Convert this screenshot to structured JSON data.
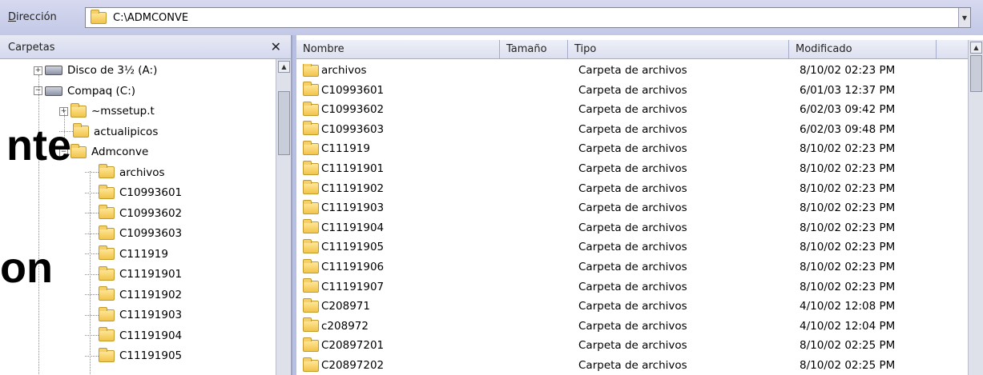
{
  "address": {
    "label_u": "D",
    "label_rest": "irección",
    "path": "C:\\ADMCONVE",
    "dropdown_glyph": "▼"
  },
  "folders_pane": {
    "title": "Carpetas",
    "close_glyph": "✕",
    "tree": [
      {
        "label": "Disco de 3½ (A:)",
        "expander": "+",
        "icon": "floppy-drive-icon"
      },
      {
        "label": "Compaq (C:)",
        "expander": "−",
        "icon": "hard-drive-icon"
      },
      {
        "label": "~mssetup.t",
        "expander": "+",
        "icon": "folder-icon"
      },
      {
        "label": "actualipicos",
        "expander": "",
        "icon": "folder-icon"
      },
      {
        "label": "Admconve",
        "expander": "−",
        "icon": "folder-icon"
      },
      {
        "label": "archivos",
        "expander": "",
        "icon": "folder-icon"
      },
      {
        "label": "C10993601",
        "expander": "",
        "icon": "folder-icon"
      },
      {
        "label": "C10993602",
        "expander": "",
        "icon": "folder-icon"
      },
      {
        "label": "C10993603",
        "expander": "",
        "icon": "folder-icon"
      },
      {
        "label": "C111919",
        "expander": "",
        "icon": "folder-icon"
      },
      {
        "label": "C11191901",
        "expander": "",
        "icon": "folder-icon"
      },
      {
        "label": "C11191902",
        "expander": "",
        "icon": "folder-icon"
      },
      {
        "label": "C11191903",
        "expander": "",
        "icon": "folder-icon"
      },
      {
        "label": "C11191904",
        "expander": "",
        "icon": "folder-icon"
      },
      {
        "label": "C11191905",
        "expander": "",
        "icon": "folder-icon"
      }
    ]
  },
  "overlay": {
    "line1": "nte",
    "line2": "on"
  },
  "files": {
    "columns": [
      "Nombre",
      "Tamaño",
      "Tipo",
      "Modificado"
    ],
    "rows": [
      {
        "name": "archivos",
        "type": "Carpeta de archivos",
        "modified": "8/10/02 02:23 PM"
      },
      {
        "name": "C10993601",
        "type": "Carpeta de archivos",
        "modified": "6/01/03 12:37 PM"
      },
      {
        "name": "C10993602",
        "type": "Carpeta de archivos",
        "modified": "6/02/03 09:42 PM"
      },
      {
        "name": "C10993603",
        "type": "Carpeta de archivos",
        "modified": "6/02/03 09:48 PM"
      },
      {
        "name": "C111919",
        "type": "Carpeta de archivos",
        "modified": "8/10/02 02:23 PM"
      },
      {
        "name": "C11191901",
        "type": "Carpeta de archivos",
        "modified": "8/10/02 02:23 PM"
      },
      {
        "name": "C11191902",
        "type": "Carpeta de archivos",
        "modified": "8/10/02 02:23 PM"
      },
      {
        "name": "C11191903",
        "type": "Carpeta de archivos",
        "modified": "8/10/02 02:23 PM"
      },
      {
        "name": "C11191904",
        "type": "Carpeta de archivos",
        "modified": "8/10/02 02:23 PM"
      },
      {
        "name": "C11191905",
        "type": "Carpeta de archivos",
        "modified": "8/10/02 02:23 PM"
      },
      {
        "name": "C11191906",
        "type": "Carpeta de archivos",
        "modified": "8/10/02 02:23 PM"
      },
      {
        "name": "C11191907",
        "type": "Carpeta de archivos",
        "modified": "8/10/02 02:23 PM"
      },
      {
        "name": "C208971",
        "type": "Carpeta de archivos",
        "modified": "4/10/02 12:08 PM"
      },
      {
        "name": "c208972",
        "type": "Carpeta de archivos",
        "modified": "4/10/02 12:04 PM"
      },
      {
        "name": "C20897201",
        "type": "Carpeta de archivos",
        "modified": "8/10/02 02:25 PM"
      },
      {
        "name": "C20897202",
        "type": "Carpeta de archivos",
        "modified": "8/10/02 02:25 PM"
      }
    ]
  },
  "scroll_glyphs": {
    "up": "▲"
  }
}
